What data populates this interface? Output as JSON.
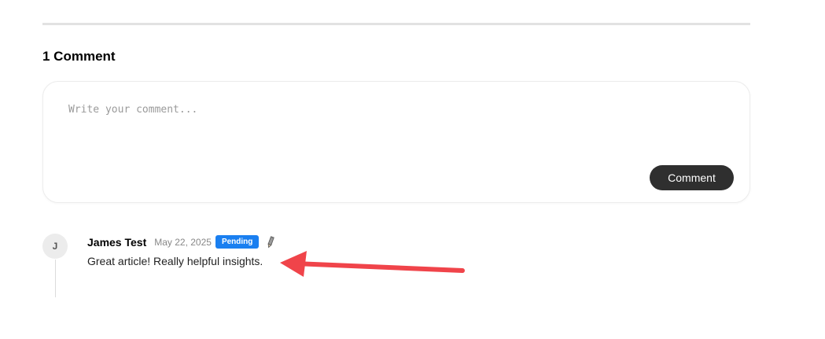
{
  "comments": {
    "heading": "1 Comment",
    "composer": {
      "placeholder": "Write your comment...",
      "value": "",
      "submit_label": "Comment"
    },
    "items": [
      {
        "avatar_initial": "J",
        "author": "James Test",
        "date": "May 22, 2025",
        "status": "Pending",
        "text": "Great article! Really helpful insights."
      }
    ]
  },
  "colors": {
    "badge": "#1a7ff0",
    "button": "#2f2f2f",
    "annotation_arrow": "#f0444a"
  },
  "icons": {
    "edit": "pencil-icon",
    "annotation": "arrow-annotation"
  }
}
